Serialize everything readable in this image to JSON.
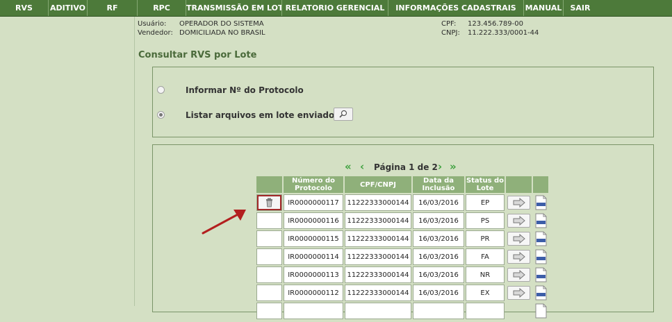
{
  "nav": [
    "RVS",
    "ADITIVO",
    "RF",
    "RPC",
    "TRANSMISSÃO EM LOTE",
    "RELATORIO GERENCIAL",
    "INFORMAÇÕES CADASTRAIS",
    "MANUAL",
    "SAIR"
  ],
  "user": {
    "usuario_label": "Usuário:",
    "usuario_value": "OPERADOR DO SISTEMA",
    "vendedor_label": "Vendedor:",
    "vendedor_value": "DOMICILIADA NO BRASIL",
    "cpf_label": "CPF:",
    "cpf_value": "123.456.789-00",
    "cnpj_label": "CNPJ:",
    "cnpj_value": "11.222.333/0001-44"
  },
  "page_title": "Consultar RVS por Lote",
  "options": {
    "opt1_label": "Informar Nº do Protocolo",
    "opt2_label": "Listar arquivos em lote enviados",
    "selected": "opt2"
  },
  "pager": {
    "text": "Página 1 de 2"
  },
  "table": {
    "headers": [
      "",
      "Número do Protocolo",
      "CPF/CNPJ",
      "Data da Inclusão",
      "Status do Lote",
      "",
      ""
    ],
    "rows": [
      {
        "protocolo": "IR0000000117",
        "cpf": "11222333000144",
        "data": "16/03/2016",
        "status": "EP"
      },
      {
        "protocolo": "IR0000000116",
        "cpf": "11222333000144",
        "data": "16/03/2016",
        "status": "PS"
      },
      {
        "protocolo": "IR0000000115",
        "cpf": "11222333000144",
        "data": "16/03/2016",
        "status": "PR"
      },
      {
        "protocolo": "IR0000000114",
        "cpf": "11222333000144",
        "data": "16/03/2016",
        "status": "FA"
      },
      {
        "protocolo": "IR0000000113",
        "cpf": "11222333000144",
        "data": "16/03/2016",
        "status": "NR"
      },
      {
        "protocolo": "IR0000000112",
        "cpf": "11222333000144",
        "data": "16/03/2016",
        "status": "EX"
      }
    ]
  },
  "colors": {
    "nav_bg": "#4d7a3a",
    "header_bg": "#8fb07a",
    "page_bg": "#d4e0c4",
    "highlight": "#a32929"
  }
}
